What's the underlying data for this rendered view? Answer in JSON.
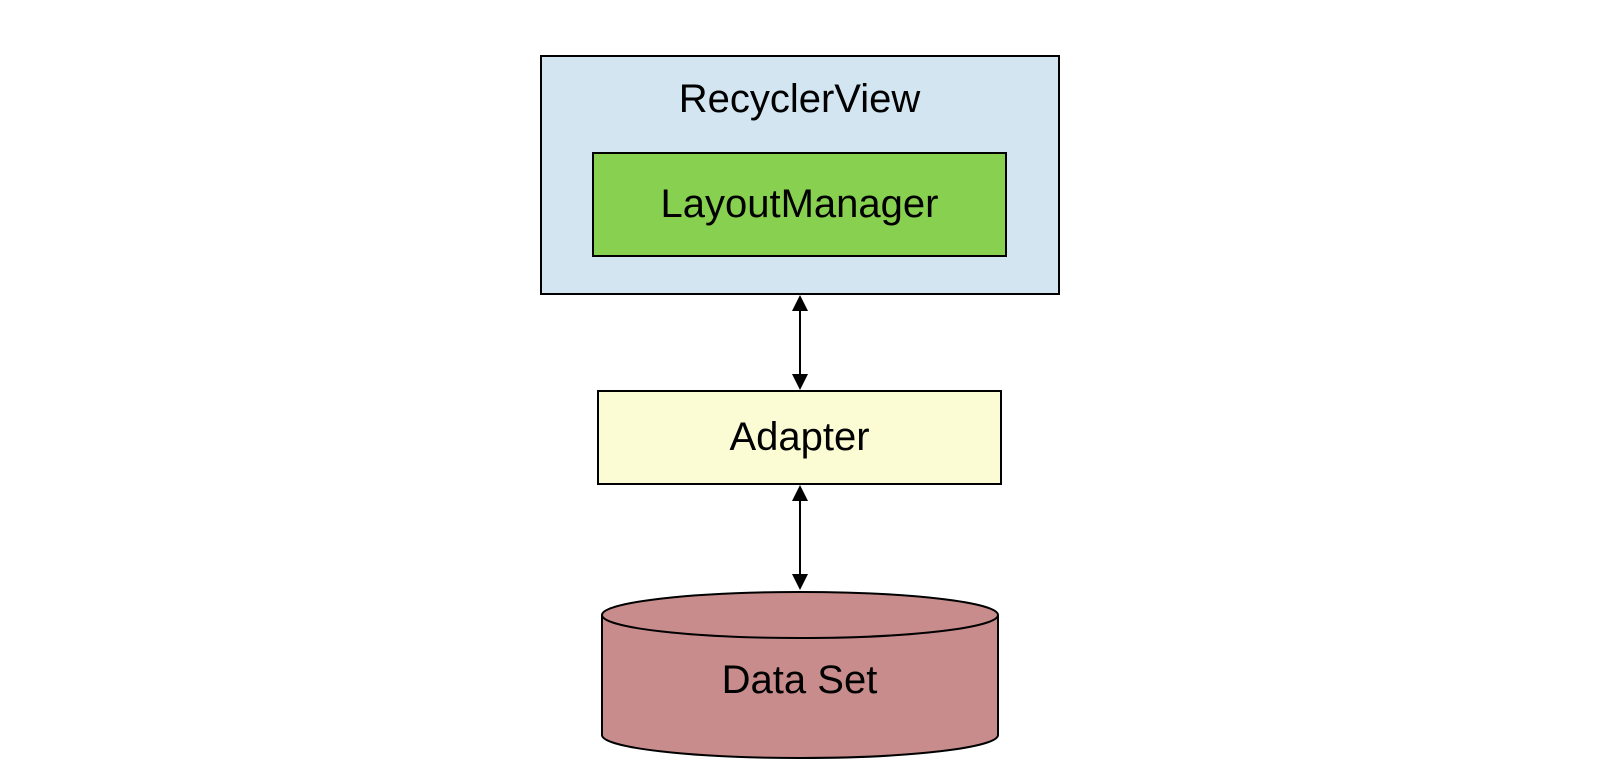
{
  "diagram": {
    "recycler_view_label": "RecyclerView",
    "layout_manager_label": "LayoutManager",
    "adapter_label": "Adapter",
    "data_set_label": "Data Set",
    "colors": {
      "recycler_bg": "#d2e5f0",
      "layout_manager_bg": "#87d050",
      "adapter_bg": "#fcfcd4",
      "data_set_bg": "#c88c8c"
    }
  }
}
